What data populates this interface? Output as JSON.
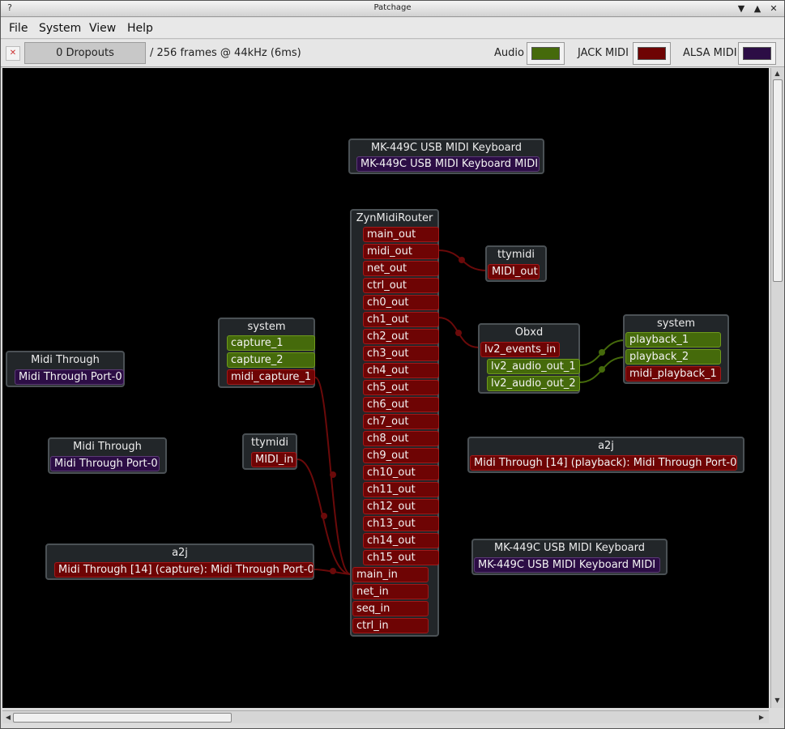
{
  "window": {
    "title": "Patchage"
  },
  "menubar": {
    "file": "File",
    "system": "System",
    "view": "View",
    "help": "Help"
  },
  "toolbar": {
    "dropouts": "0 Dropouts",
    "buffer_info": "/ 256 frames @ 44kHz (6ms)",
    "audio_label": "Audio",
    "jack_midi_label": "JACK MIDI",
    "alsa_midi_label": "ALSA MIDI"
  },
  "colors": {
    "audio": "#456a0b",
    "jack_midi": "#6e0404",
    "alsa_midi": "#2c0d45",
    "canvas": "#000000"
  },
  "modules": {
    "mk_top": {
      "title": "MK-449C USB MIDI Keyboard",
      "ports": [
        "MK-449C USB MIDI Keyboard MIDI"
      ]
    },
    "zyn": {
      "title": "ZynMidiRouter",
      "outputs": [
        "main_out",
        "midi_out",
        "net_out",
        "ctrl_out",
        "ch0_out",
        "ch1_out",
        "ch2_out",
        "ch3_out",
        "ch4_out",
        "ch5_out",
        "ch6_out",
        "ch7_out",
        "ch8_out",
        "ch9_out",
        "ch10_out",
        "ch11_out",
        "ch12_out",
        "ch13_out",
        "ch14_out",
        "ch15_out"
      ],
      "inputs": [
        "main_in",
        "net_in",
        "seq_in",
        "ctrl_in"
      ]
    },
    "ttymidi_out": {
      "title": "ttymidi",
      "ports": [
        "MIDI_out"
      ]
    },
    "system_capture": {
      "title": "system",
      "ports": [
        "capture_1",
        "capture_2",
        "midi_capture_1"
      ]
    },
    "obxd": {
      "title": "Obxd",
      "ports": [
        "lv2_events_in",
        "lv2_audio_out_1",
        "lv2_audio_out_2"
      ]
    },
    "system_playback": {
      "title": "system",
      "ports": [
        "playback_1",
        "playback_2",
        "midi_playback_1"
      ]
    },
    "midi_through_1": {
      "title": "Midi Through",
      "ports": [
        "Midi Through Port-0"
      ]
    },
    "midi_through_2": {
      "title": "Midi Through",
      "ports": [
        "Midi Through Port-0"
      ]
    },
    "ttymidi_in": {
      "title": "ttymidi",
      "ports": [
        "MIDI_in"
      ]
    },
    "a2j_right": {
      "title": "a2j",
      "ports": [
        "Midi Through [14] (playback): Midi Through Port-0"
      ]
    },
    "a2j_left": {
      "title": "a2j",
      "ports": [
        "Midi Through [14] (capture): Midi Through Port-0"
      ]
    },
    "mk_bottom": {
      "title": "MK-449C USB MIDI Keyboard",
      "ports": [
        "MK-449C USB MIDI Keyboard MIDI"
      ]
    }
  }
}
